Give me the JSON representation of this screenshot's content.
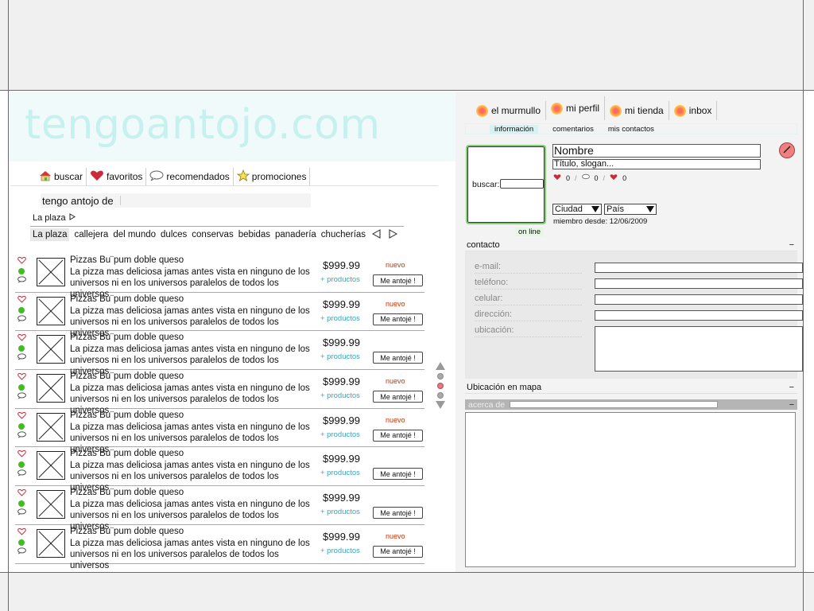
{
  "site": {
    "logo": "tengoantojo.com"
  },
  "nav": [
    {
      "label": "buscar",
      "icon": "house-icon"
    },
    {
      "label": "favoritos",
      "icon": "heart-icon"
    },
    {
      "label": "recomendados",
      "icon": "speech-bubble-icon"
    },
    {
      "label": "promociones",
      "icon": "star-icon"
    }
  ],
  "search": {
    "label": "tengo antojo de"
  },
  "plaza": {
    "title": "La plaza",
    "categories": [
      "La plaza",
      "callejera",
      "del mundo",
      "dulces",
      "conservas",
      "bebidas",
      "panadería",
      "chucherías"
    ]
  },
  "product": {
    "title": "Pizzas Bu¨pum doble queso",
    "desc": "La pizza mas deliciosa jamas antes vista en ninguno de los universos ni en los universos paralelos de todos los universos",
    "price": "$999.99",
    "more": "+ productos",
    "button": "Me antojé !",
    "new_label": "nuevo"
  },
  "items_new": [
    true,
    true,
    false,
    true,
    true,
    false,
    false,
    true
  ],
  "profile": {
    "tabs": [
      "el murmullo",
      "mi perfil",
      "mi tienda",
      "inbox"
    ],
    "subtabs": [
      "información",
      "comentarios",
      "mis contactos"
    ],
    "search_label": "buscar:",
    "online": "on line",
    "name": "Nombre",
    "slogan": "Título, slogan...",
    "stats": [
      "0",
      "0",
      "0"
    ],
    "city": "Ciudad",
    "country": "País",
    "member_since": "miembro desde: 12/06/2009"
  },
  "contact": {
    "title": "contacto",
    "collapse": "−",
    "fields": [
      "e-mail:",
      "teléfono:",
      "celular:",
      "dirección:",
      "ubicación:"
    ]
  },
  "map": {
    "title": "Ubicación en mapa",
    "collapse": "−"
  },
  "about": {
    "title": "acerca de",
    "collapse": "−"
  },
  "colors": {
    "logo": "#c6f1ee",
    "heart": "#cc2a3a",
    "online_dot": "#44bb22",
    "accent_link": "#33a8c0",
    "new_badge": "#cc3300"
  }
}
